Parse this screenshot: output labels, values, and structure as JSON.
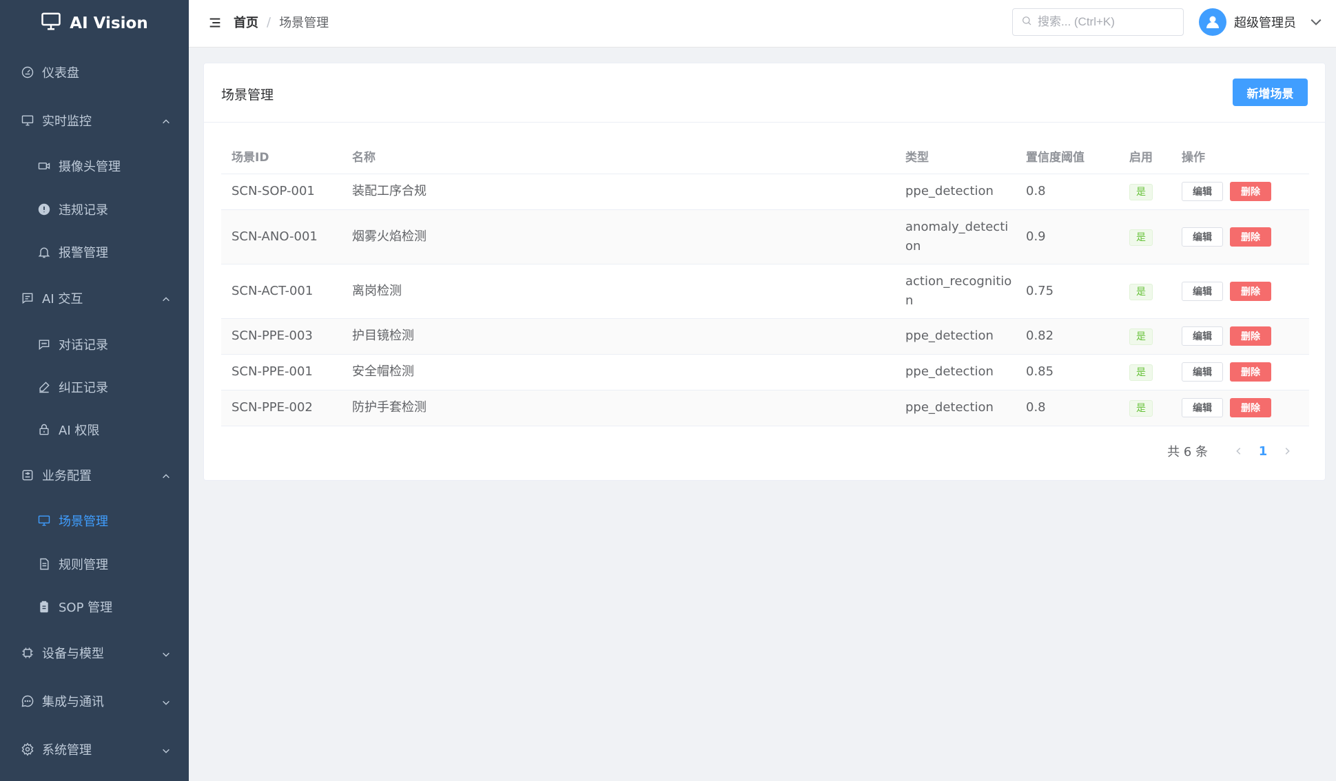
{
  "app": {
    "name": "AI Vision"
  },
  "sidebar": {
    "items": [
      {
        "label": "仪表盘",
        "icon": "dashboard-icon"
      },
      {
        "label": "实时监控",
        "icon": "monitor-icon",
        "expanded": true
      },
      {
        "label": "摄像头管理",
        "icon": "camera-icon"
      },
      {
        "label": "违规记录",
        "icon": "warning-icon"
      },
      {
        "label": "报警管理",
        "icon": "bell-icon"
      },
      {
        "label": "AI 交互",
        "icon": "ai-chat-icon",
        "expanded": true
      },
      {
        "label": "对话记录",
        "icon": "chat-icon"
      },
      {
        "label": "纠正记录",
        "icon": "edit-pen-icon"
      },
      {
        "label": "AI 权限",
        "icon": "lock-icon"
      },
      {
        "label": "业务配置",
        "icon": "config-icon",
        "expanded": true
      },
      {
        "label": "场景管理",
        "icon": "monitor-icon",
        "active": true
      },
      {
        "label": "规则管理",
        "icon": "document-icon"
      },
      {
        "label": "SOP 管理",
        "icon": "clipboard-icon"
      },
      {
        "label": "设备与模型",
        "icon": "cpu-icon",
        "expanded": false
      },
      {
        "label": "集成与通讯",
        "icon": "chat-dots-icon",
        "expanded": false
      },
      {
        "label": "系统管理",
        "icon": "gear-icon",
        "expanded": false
      }
    ]
  },
  "header": {
    "breadcrumb": {
      "home": "首页",
      "separator": "/",
      "current": "场景管理"
    },
    "search_placeholder": "搜索... (Ctrl+K)",
    "username": "超级管理员"
  },
  "card": {
    "title": "场景管理",
    "add_button": "新增场景"
  },
  "table": {
    "columns": [
      "场景ID",
      "名称",
      "类型",
      "置信度阈值",
      "启用",
      "操作"
    ],
    "rows": [
      {
        "id": "SCN-SOP-001",
        "name": "装配工序合规",
        "type": "ppe_detection",
        "confidence": "0.8",
        "enabled": "是"
      },
      {
        "id": "SCN-ANO-001",
        "name": "烟雾火焰检测",
        "type": "anomaly_detection",
        "confidence": "0.9",
        "enabled": "是"
      },
      {
        "id": "SCN-ACT-001",
        "name": "离岗检测",
        "type": "action_recognition",
        "confidence": "0.75",
        "enabled": "是"
      },
      {
        "id": "SCN-PPE-003",
        "name": "护目镜检测",
        "type": "ppe_detection",
        "confidence": "0.82",
        "enabled": "是"
      },
      {
        "id": "SCN-PPE-001",
        "name": "安全帽检测",
        "type": "ppe_detection",
        "confidence": "0.85",
        "enabled": "是"
      },
      {
        "id": "SCN-PPE-002",
        "name": "防护手套检测",
        "type": "ppe_detection",
        "confidence": "0.8",
        "enabled": "是"
      }
    ],
    "edit_label": "编辑",
    "delete_label": "删除"
  },
  "pagination": {
    "total": "共 6 条",
    "current_page": "1"
  },
  "colors": {
    "sidebar_bg": "#304156",
    "accent": "#409eff",
    "danger": "#f56c6c",
    "success": "#67c23a"
  }
}
